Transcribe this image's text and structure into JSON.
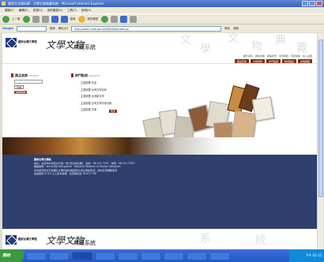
{
  "window": {
    "title": "國家文化資料庫 - 文學文物典藏系統 - Microsoft Internet Explorer"
  },
  "menu": [
    "檔案(F)",
    "編輯(E)",
    "檢視(V)",
    "我的最愛(A)",
    "工具(T)",
    "說明(H)"
  ],
  "toolbar": {
    "back_label": "上一頁",
    "search_label": "搜尋",
    "favorites_label": "我的最愛"
  },
  "linksbar": {
    "google_label": "Google",
    "search_label": "搜尋",
    "address_label": "網址(D)",
    "address_value": "http://www2.nmtl.gov.tw:8080/lib/index.jsp",
    "go_label": "移至",
    "links_label": "連結"
  },
  "header": {
    "org_name": "國家台灣文學館",
    "brand": "文學文物",
    "brand_sub": "典藏系統",
    "watermark": [
      "文",
      "學",
      "文",
      "物",
      "典",
      "藏",
      "系",
      "統"
    ],
    "top_nav": [
      "關於本館",
      "網站地圖",
      "聯絡我們",
      "常見問題",
      "意見信箱",
      "加入最愛"
    ],
    "sub_nav": [
      "藏品查詢",
      "分類瀏覽",
      "熱門點閱",
      "精選藏品",
      "文物典藏"
    ]
  },
  "search_panel": {
    "title": "藏品查詢",
    "subtitle": "SEARCH",
    "button": "查詢",
    "advanced": "進階查詢"
  },
  "hot_panel": {
    "title": "熱門點閱",
    "subtitle": "BROWSE",
    "items": [
      "‧ 主題收藏 作品",
      "‧ 主題收藏 台灣文學百年",
      "‧ 主題收藏 台灣新文學",
      "‧ 主題收藏 台灣文學作家手稿",
      "‧ 主題收藏 作家"
    ],
    "more": "更多"
  },
  "footer": {
    "title": "國家台灣文學館",
    "lines": [
      "地址：台南市中西區中正路一號 (原台南州廳)　電話：06-221-7201　傳真：06-221-7203",
      "網路服務：service@nmtl.gov.tw　National Museum of Taiwan Literature",
      "本系統所有文字與圖片之著作權均屬國家台灣文學館所有，請勿任意轉載使用",
      "建議使用 IE 6.0 以上版本瀏覽，最佳解析度 1024 x 768"
    ]
  },
  "taskbar": {
    "start": "開始",
    "clock": "下午 02:15"
  },
  "colors": {
    "accent": "#7e3217",
    "footer_bg": "#2f3f6e",
    "title_bar": "#3a62b8"
  }
}
